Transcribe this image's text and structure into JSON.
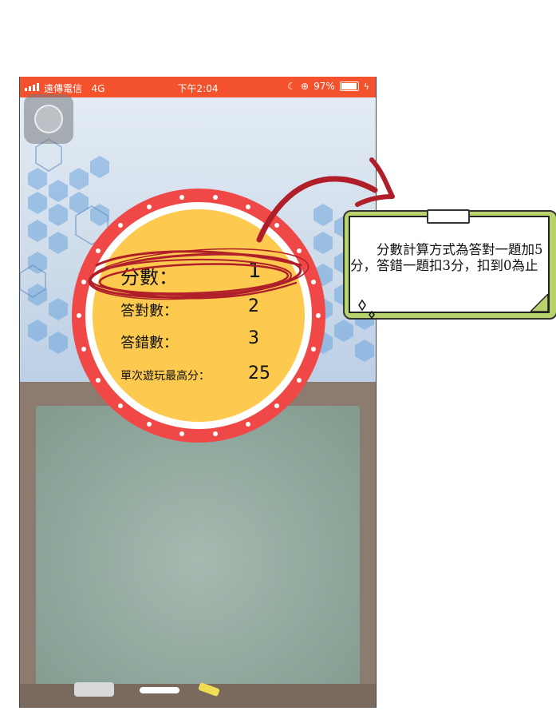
{
  "status_bar": {
    "carrier": "遠傳電信",
    "network": "4G",
    "time": "下午2:04",
    "battery": "97%"
  },
  "scores": {
    "score_label": "分數：",
    "score_value": "1",
    "correct_label": "答對數：",
    "correct_value": "2",
    "wrong_label": "答錯數：",
    "wrong_value": "3",
    "best_label": "單次遊玩最高分：",
    "best_value": "25"
  },
  "annotation": {
    "note_text": "分數計算方式為答對一題加5分，答錯一題扣3分，扣到0為止"
  },
  "colors": {
    "status_bar": "#f4522c",
    "disc_ring": "#ef4847",
    "disc_fill": "#fdc94e",
    "highlight_scribble": "#b01e2a",
    "note_border": "#b9d36c"
  },
  "icons": [
    "signal-icon",
    "moon-icon",
    "rotation-lock-icon",
    "battery-icon",
    "charging-icon",
    "arrow-icon",
    "sparkle-icon"
  ]
}
